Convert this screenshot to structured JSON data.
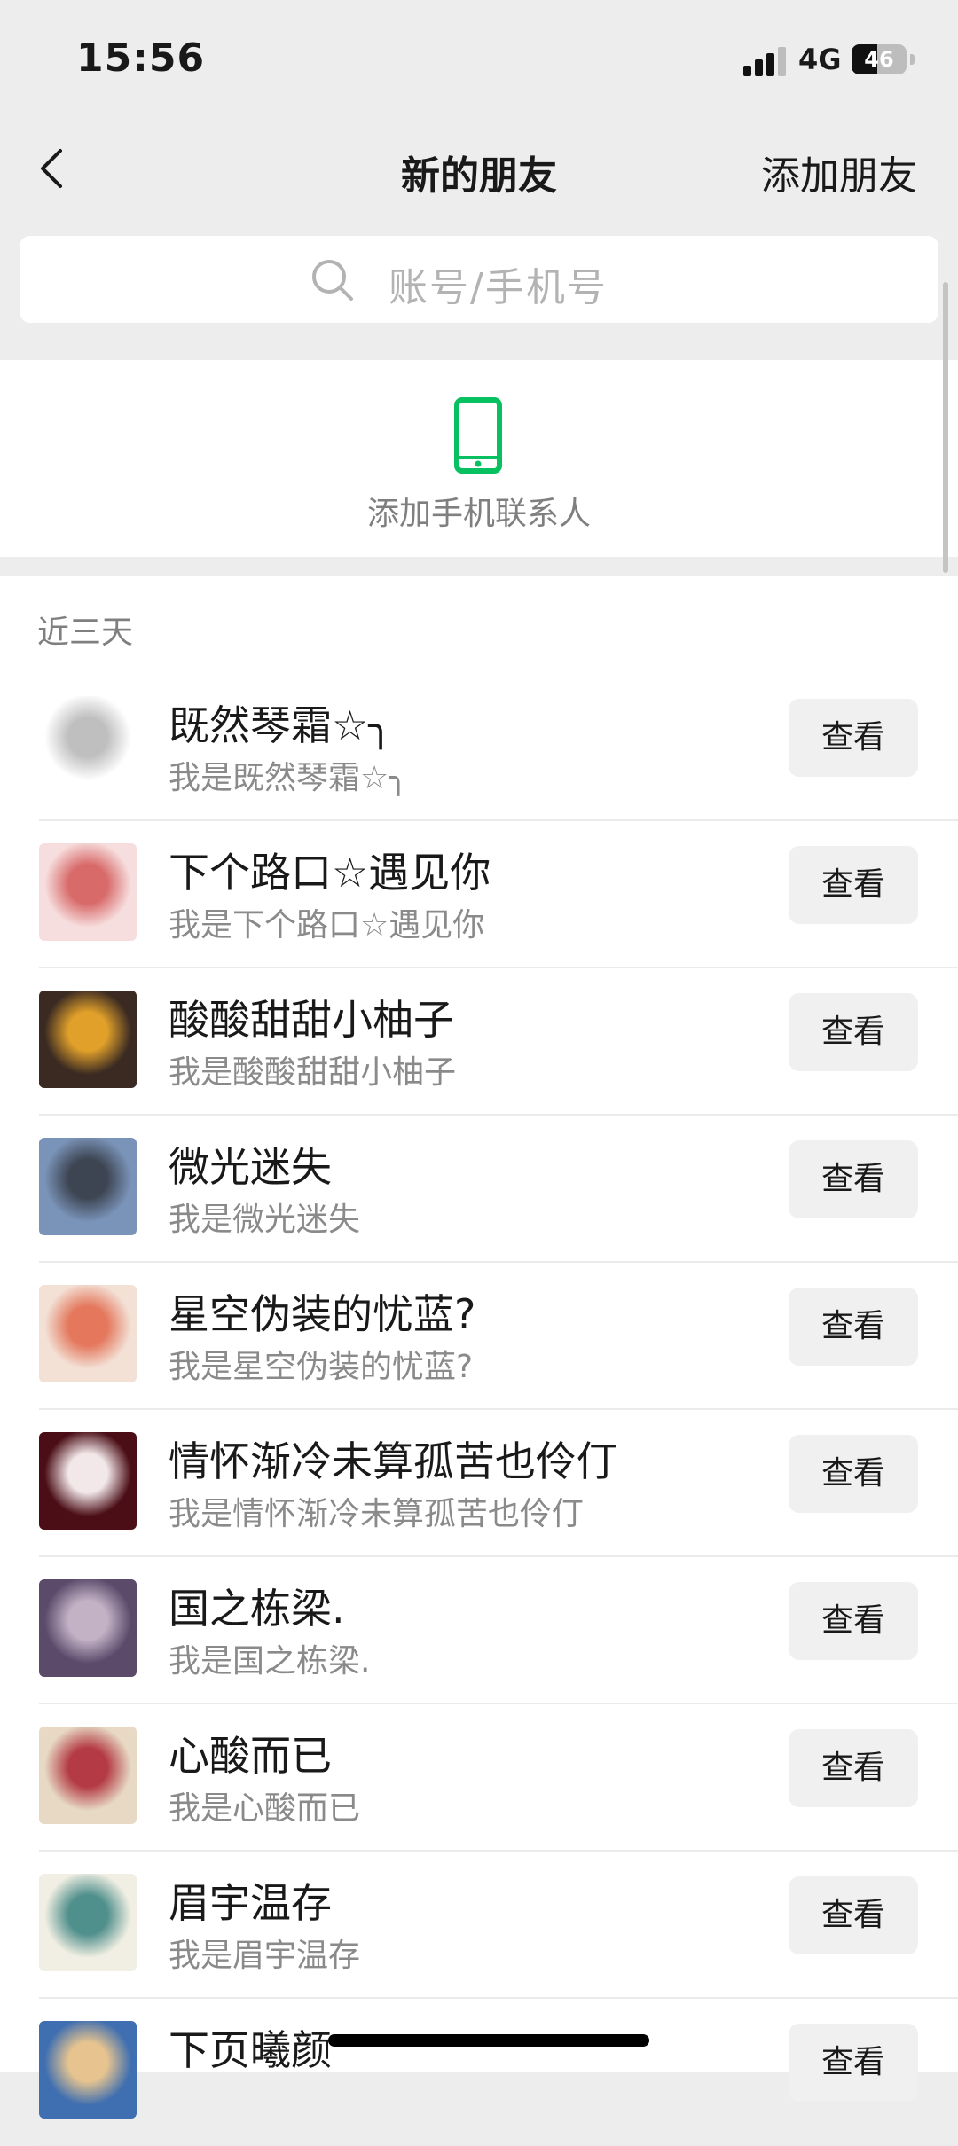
{
  "status_bar": {
    "time": "15:56",
    "network": "4G",
    "battery": "46",
    "battery_level": 0.46
  },
  "nav": {
    "back_icon": "chevron-left-icon",
    "title": "新的朋友",
    "action": "添加朋友"
  },
  "search": {
    "placeholder": "账号/手机号",
    "icon": "search-icon"
  },
  "phone_contacts": {
    "label": "添加手机联系人",
    "icon": "phone-icon",
    "icon_color": "#07c160"
  },
  "section": {
    "label": "近三天"
  },
  "contacts": [
    {
      "name": "既然琴霜☆╮",
      "greeting": "我是既然琴霜☆╮",
      "button": "查看",
      "avatar_colors": [
        "#ffffff",
        "#bfbfbf"
      ]
    },
    {
      "name": "下个路口☆遇见你",
      "greeting": "我是下个路口☆遇见你",
      "button": "查看",
      "avatar_colors": [
        "#f7dede",
        "#d86a6a"
      ]
    },
    {
      "name": "酸酸甜甜小柚子",
      "greeting": "我是酸酸甜甜小柚子",
      "button": "查看",
      "avatar_colors": [
        "#3a2a22",
        "#e0a02a"
      ]
    },
    {
      "name": "微光迷失",
      "greeting": "我是微光迷失",
      "button": "查看",
      "avatar_colors": [
        "#7a93b8",
        "#3d4552"
      ]
    },
    {
      "name": "星空伪装的忧蓝?",
      "greeting": "我是星空伪装的忧蓝?",
      "button": "查看",
      "avatar_colors": [
        "#f3e1d6",
        "#e4775c"
      ]
    },
    {
      "name": "情怀渐冷未算孤苦也伶仃",
      "greeting": "我是情怀渐冷未算孤苦也伶仃",
      "button": "查看",
      "avatar_colors": [
        "#4b0e16",
        "#f2e8ea"
      ]
    },
    {
      "name": "国之栋梁.",
      "greeting": "我是国之栋梁.",
      "button": "查看",
      "avatar_colors": [
        "#5b4a6a",
        "#c3b2c6"
      ]
    },
    {
      "name": "心酸而已",
      "greeting": "我是心酸而已",
      "button": "查看",
      "avatar_colors": [
        "#e7d9c4",
        "#b43b45"
      ]
    },
    {
      "name": "眉宇温存",
      "greeting": "我是眉宇温存",
      "button": "查看",
      "avatar_colors": [
        "#f1efe3",
        "#4f8f8c"
      ]
    },
    {
      "name": "下页曦颜",
      "greeting": "",
      "button": "查看",
      "avatar_colors": [
        "#3f6fb0",
        "#e7c48f"
      ]
    }
  ]
}
